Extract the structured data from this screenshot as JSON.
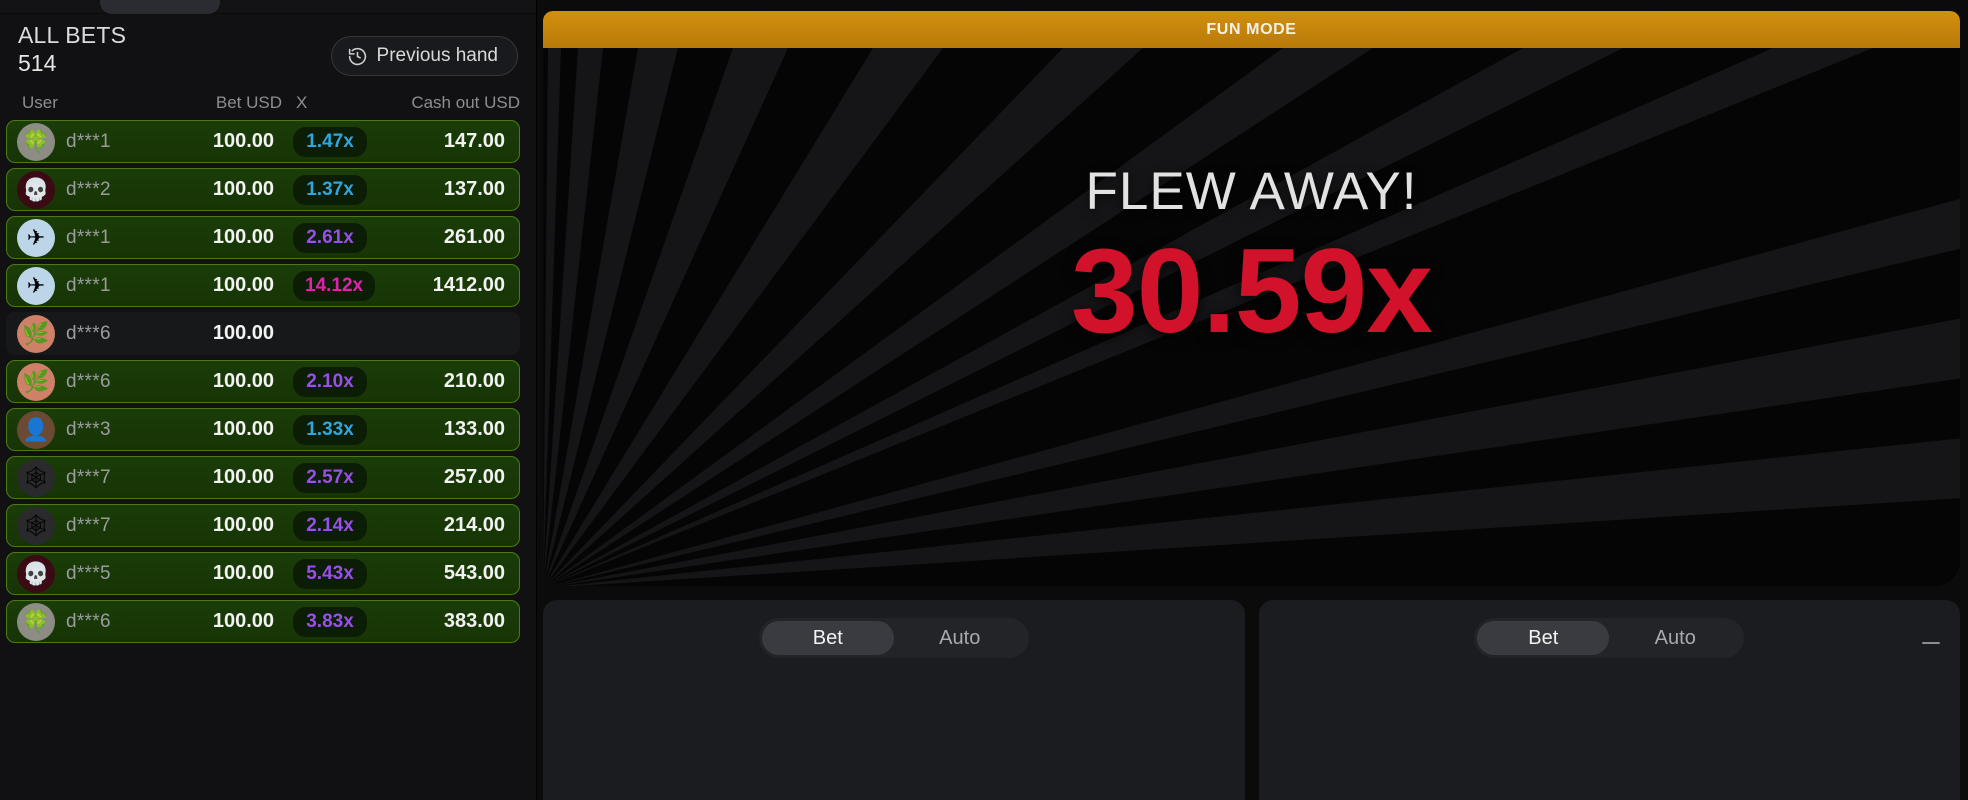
{
  "left_panel": {
    "header": {
      "all_bets_label": "ALL BETS",
      "bets_count": "514",
      "previous_hand_label": "Previous hand",
      "previous_hand_icon": "history-clock-icon"
    },
    "columns": {
      "user": "User",
      "bet": "Bet USD",
      "multiplier": "X",
      "cashout": "Cash out USD"
    },
    "rows": [
      {
        "user": "d***1",
        "bet": "100.00",
        "mult": "1.47x",
        "cashout": "147.00",
        "won": true,
        "mult_color": "#2ea6e0",
        "avatar_glyph": "🍀",
        "avatar_bg": "#8d8d85"
      },
      {
        "user": "d***2",
        "bet": "100.00",
        "mult": "1.37x",
        "cashout": "137.00",
        "won": true,
        "mult_color": "#2ea6e0",
        "avatar_glyph": "💀",
        "avatar_bg": "#3a0b14"
      },
      {
        "user": "d***1",
        "bet": "100.00",
        "mult": "2.61x",
        "cashout": "261.00",
        "won": true,
        "mult_color": "#9a4df0",
        "avatar_glyph": "✈",
        "avatar_bg": "#bcd5e8"
      },
      {
        "user": "d***1",
        "bet": "100.00",
        "mult": "14.12x",
        "cashout": "1412.00",
        "won": true,
        "mult_color": "#e31fb0",
        "avatar_glyph": "✈",
        "avatar_bg": "#bcd5e8"
      },
      {
        "user": "d***6",
        "bet": "100.00",
        "mult": "",
        "cashout": "",
        "won": false,
        "mult_color": "#9b9c9f",
        "avatar_glyph": "🌿",
        "avatar_bg": "#cf8068"
      },
      {
        "user": "d***6",
        "bet": "100.00",
        "mult": "2.10x",
        "cashout": "210.00",
        "won": true,
        "mult_color": "#9a4df0",
        "avatar_glyph": "🌿",
        "avatar_bg": "#cf8068"
      },
      {
        "user": "d***3",
        "bet": "100.00",
        "mult": "1.33x",
        "cashout": "133.00",
        "won": true,
        "mult_color": "#2ea6e0",
        "avatar_glyph": "👤",
        "avatar_bg": "#6b4a33"
      },
      {
        "user": "d***7",
        "bet": "100.00",
        "mult": "2.57x",
        "cashout": "257.00",
        "won": true,
        "mult_color": "#9a4df0",
        "avatar_glyph": "🕸",
        "avatar_bg": "#2a2a2c"
      },
      {
        "user": "d***7",
        "bet": "100.00",
        "mult": "2.14x",
        "cashout": "214.00",
        "won": true,
        "mult_color": "#9a4df0",
        "avatar_glyph": "🕸",
        "avatar_bg": "#2a2a2c"
      },
      {
        "user": "d***5",
        "bet": "100.00",
        "mult": "5.43x",
        "cashout": "543.00",
        "won": true,
        "mult_color": "#9a4df0",
        "avatar_glyph": "💀",
        "avatar_bg": "#3a0b14"
      },
      {
        "user": "d***6",
        "bet": "100.00",
        "mult": "3.83x",
        "cashout": "383.00",
        "won": true,
        "mult_color": "#9a4df0",
        "avatar_glyph": "🍀",
        "avatar_bg": "#8d8d85"
      }
    ]
  },
  "game": {
    "mode_banner": "FUN MODE",
    "crash_label": "FLEW AWAY!",
    "crash_multiplier": "30.59x",
    "colors": {
      "banner_bg": "#c8860d",
      "crash_red": "#d2112a",
      "stage_bg": "#050505"
    }
  },
  "controls": {
    "left_panel": {
      "bet_tab": "Bet",
      "auto_tab": "Auto",
      "active_tab": "Bet"
    },
    "right_panel": {
      "bet_tab": "Bet",
      "auto_tab": "Auto",
      "active_tab": "Bet",
      "minus_icon": "minus-icon"
    }
  }
}
